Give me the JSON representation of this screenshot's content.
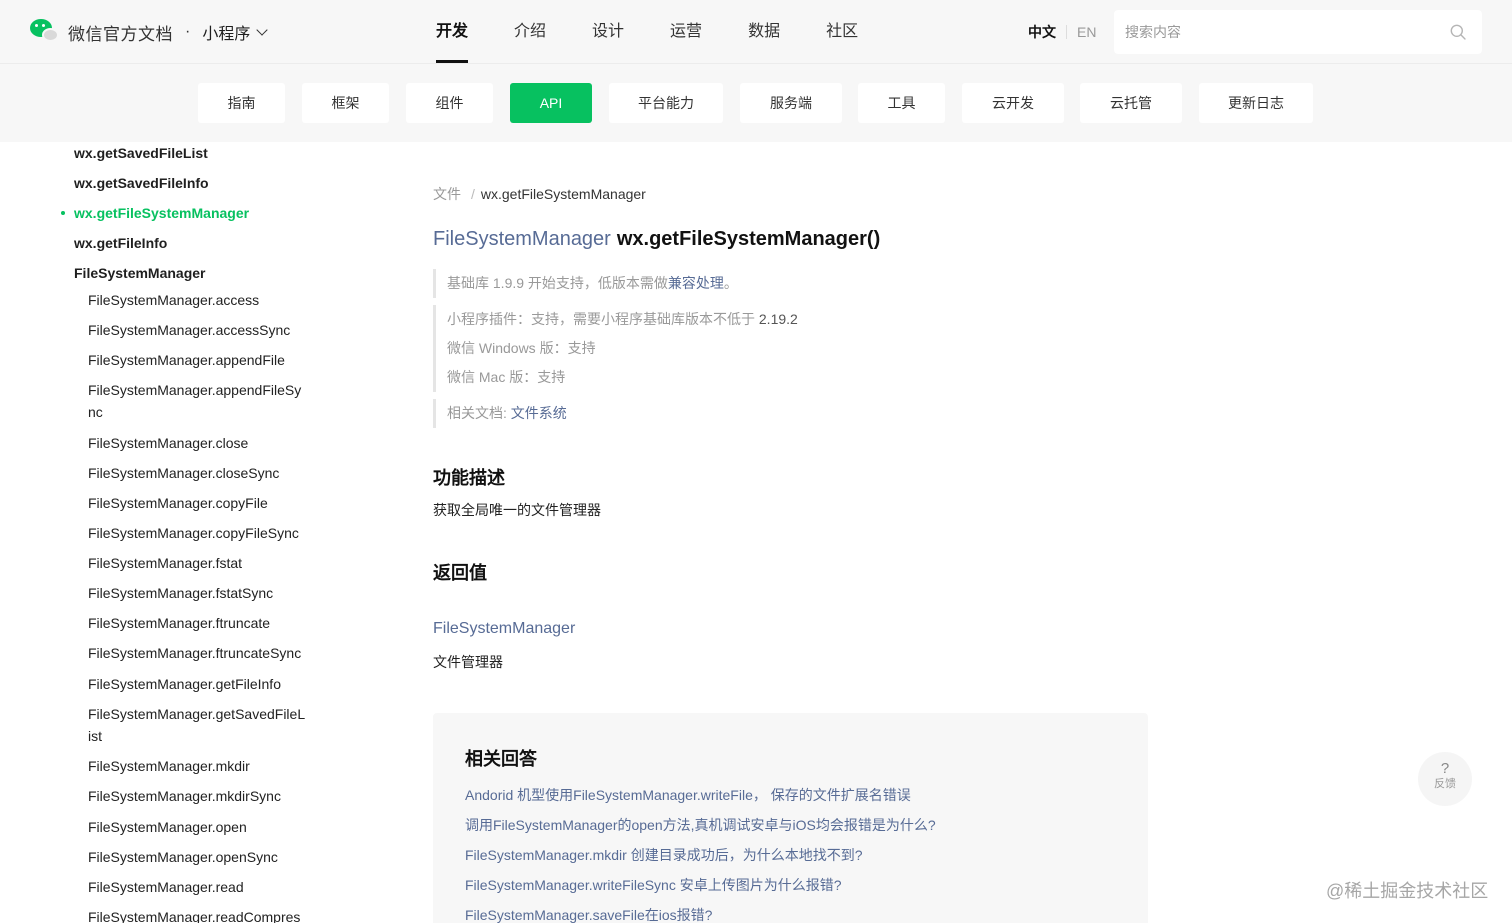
{
  "header": {
    "brand_title": "微信官方文档",
    "brand_dot": "·",
    "product": "小程序",
    "nav": [
      "开发",
      "介绍",
      "设计",
      "运营",
      "数据",
      "社区"
    ],
    "active_nav": "开发",
    "lang_zh": "中文",
    "lang_en": "EN",
    "search_placeholder": "搜索内容"
  },
  "subnav": {
    "tabs": [
      "指南",
      "框架",
      "组件",
      "API",
      "平台能力",
      "服务端",
      "工具",
      "云开发",
      "云托管",
      "更新日志"
    ],
    "active": "API"
  },
  "sidebar": {
    "items": [
      {
        "label": "wx.getSavedFileList",
        "level": 1
      },
      {
        "label": "wx.getSavedFileInfo",
        "level": 1
      },
      {
        "label": "wx.getFileSystemManager",
        "level": 1,
        "active": true
      },
      {
        "label": "wx.getFileInfo",
        "level": 1
      },
      {
        "label": "FileSystemManager",
        "level": 1
      },
      {
        "label": "FileSystemManager.access",
        "level": 2
      },
      {
        "label": "FileSystemManager.accessSync",
        "level": 2
      },
      {
        "label": "FileSystemManager.appendFile",
        "level": 2
      },
      {
        "label": "FileSystemManager.appendFileSync",
        "level": 2
      },
      {
        "label": "FileSystemManager.close",
        "level": 2
      },
      {
        "label": "FileSystemManager.closeSync",
        "level": 2
      },
      {
        "label": "FileSystemManager.copyFile",
        "level": 2
      },
      {
        "label": "FileSystemManager.copyFileSync",
        "level": 2
      },
      {
        "label": "FileSystemManager.fstat",
        "level": 2
      },
      {
        "label": "FileSystemManager.fstatSync",
        "level": 2
      },
      {
        "label": "FileSystemManager.ftruncate",
        "level": 2
      },
      {
        "label": "FileSystemManager.ftruncateSync",
        "level": 2
      },
      {
        "label": "FileSystemManager.getFileInfo",
        "level": 2
      },
      {
        "label": "FileSystemManager.getSavedFileList",
        "level": 2
      },
      {
        "label": "FileSystemManager.mkdir",
        "level": 2
      },
      {
        "label": "FileSystemManager.mkdirSync",
        "level": 2
      },
      {
        "label": "FileSystemManager.open",
        "level": 2
      },
      {
        "label": "FileSystemManager.openSync",
        "level": 2
      },
      {
        "label": "FileSystemManager.read",
        "level": 2
      },
      {
        "label": "FileSystemManager.readCompres",
        "level": 2
      }
    ]
  },
  "doc": {
    "breadcrumb_parent": "文件",
    "breadcrumb_sep": "/",
    "breadcrumb_current": "wx.getFileSystemManager",
    "title_type": "FileSystemManager",
    "title_name": "wx.getFileSystemManager()",
    "support_prefix": "基础库 1.9.9 开始支持，低版本需做",
    "support_link": "兼容处理",
    "support_suffix": "。",
    "plugin_label": "小程序插件",
    "plugin_text": "：支持，需要小程序基础库版本不低于 ",
    "plugin_version": "2.19.2",
    "windows_label": "微信 Windows 版",
    "windows_text": "：支持",
    "mac_label": "微信 Mac 版",
    "mac_text": "：支持",
    "related_label": "相关文档: ",
    "related_link": "文件系统",
    "desc_heading": "功能描述",
    "desc_text": "获取全局唯一的文件管理器",
    "return_heading": "返回值",
    "return_type": "FileSystemManager",
    "return_desc": "文件管理器"
  },
  "qa": {
    "title": "相关回答",
    "links": [
      "Andorid 机型使用FileSystemManager.writeFile， 保存的文件扩展名错误",
      "调用FileSystemManager的open方法,真机调试安卓与iOS均会报错是为什么?",
      "FileSystemManager.mkdir 创建目录成功后，为什么本地找不到?",
      "FileSystemManager.writeFileSync 安卓上传图片为什么报错?",
      "FileSystemManager.saveFile在ios报错?"
    ]
  },
  "feedback": {
    "icon": "?",
    "label": "反馈"
  },
  "watermark": "@稀土掘金技术社区",
  "colors": {
    "accent": "#07c160",
    "link": "#576b95"
  }
}
